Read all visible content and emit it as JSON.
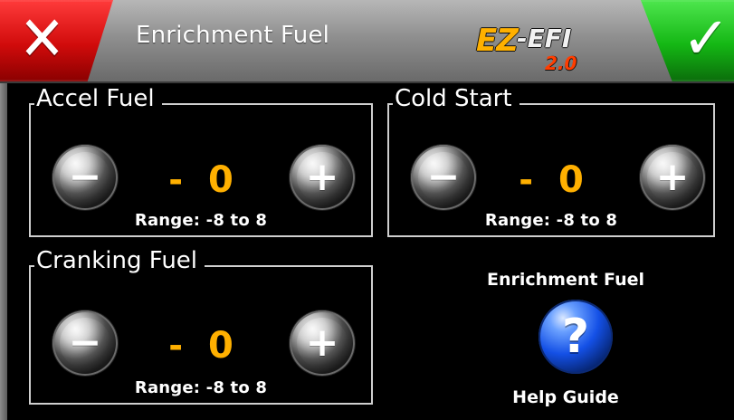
{
  "header": {
    "title": "Enrichment Fuel",
    "cancel_icon": "✕",
    "accept_icon": "✓",
    "brand": {
      "main": "EZ",
      "mid": "-EFI",
      "version": "2.0"
    }
  },
  "panels": [
    {
      "title": "Accel Fuel",
      "minus_icon": "−",
      "plus_icon": "+",
      "sign": "-",
      "value": "0",
      "range": "Range: -8 to 8"
    },
    {
      "title": "Cold Start",
      "minus_icon": "−",
      "plus_icon": "+",
      "sign": "-",
      "value": "0",
      "range": "Range: -8 to 8"
    },
    {
      "title": "Cranking Fuel",
      "minus_icon": "−",
      "plus_icon": "+",
      "sign": "-",
      "value": "0",
      "range": "Range: -8 to 8"
    }
  ],
  "help": {
    "title": "Enrichment Fuel",
    "icon": "?",
    "subtitle": "Help Guide"
  },
  "colors": {
    "value": "#ffb000",
    "cancel": "#d10b0b",
    "accept": "#14b714",
    "help": "#1450e6"
  }
}
